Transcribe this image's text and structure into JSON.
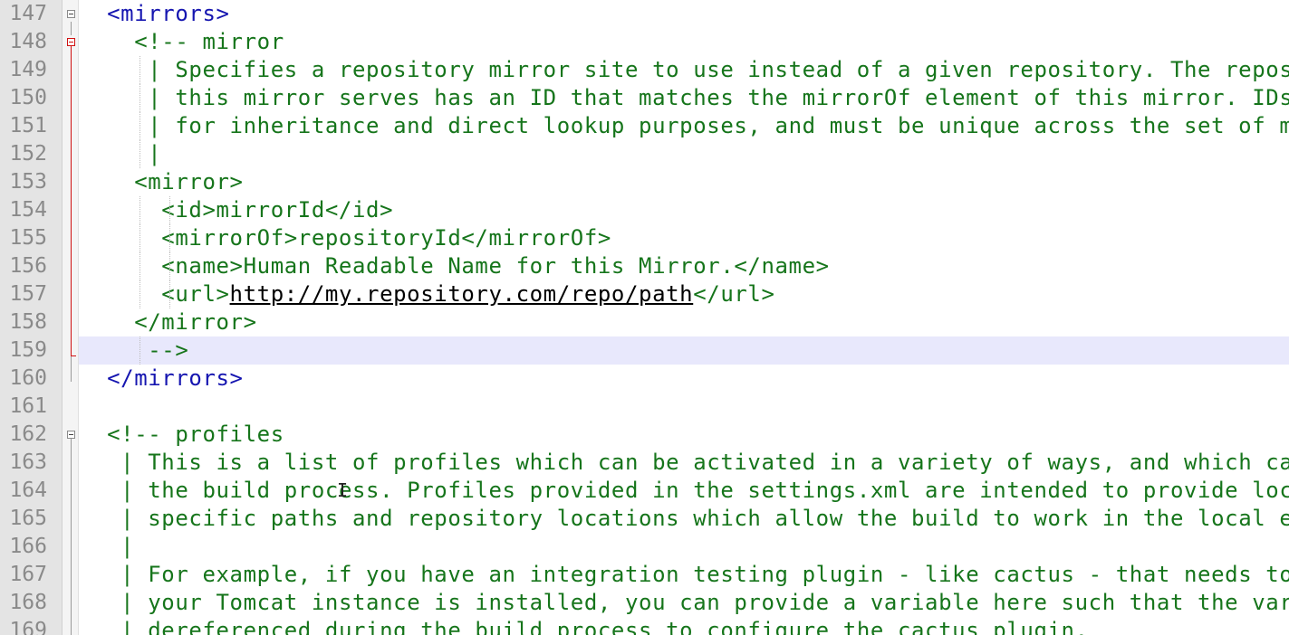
{
  "editor": {
    "fold_icon": "fold-minus-icon",
    "current_line": 159,
    "lines": [
      {
        "n": "147",
        "indent": "  ",
        "segs": [
          {
            "t": "tag",
            "v": "<mirrors>"
          }
        ]
      },
      {
        "n": "148",
        "indent": "    ",
        "segs": [
          {
            "t": "cm",
            "v": "<!-- mirror"
          }
        ]
      },
      {
        "n": "149",
        "indent": "     ",
        "segs": [
          {
            "t": "cm",
            "v": "| Specifies a repository mirror site to use instead of a given repository. The repository that"
          }
        ]
      },
      {
        "n": "150",
        "indent": "     ",
        "segs": [
          {
            "t": "cm",
            "v": "| this mirror serves has an ID that matches the mirrorOf element of this mirror. IDs are used"
          }
        ]
      },
      {
        "n": "151",
        "indent": "     ",
        "segs": [
          {
            "t": "cm",
            "v": "| for inheritance and direct lookup purposes, and must be unique across the set of mirrors."
          }
        ]
      },
      {
        "n": "152",
        "indent": "     ",
        "segs": [
          {
            "t": "cm",
            "v": "|"
          }
        ]
      },
      {
        "n": "153",
        "indent": "    ",
        "segs": [
          {
            "t": "cm",
            "v": "<mirror>"
          }
        ]
      },
      {
        "n": "154",
        "indent": "      ",
        "segs": [
          {
            "t": "cm",
            "v": "<id>mirrorId</id>"
          }
        ]
      },
      {
        "n": "155",
        "indent": "      ",
        "segs": [
          {
            "t": "cm",
            "v": "<mirrorOf>repositoryId</mirrorOf>"
          }
        ]
      },
      {
        "n": "156",
        "indent": "      ",
        "segs": [
          {
            "t": "cm",
            "v": "<name>Human Readable Name for this Mirror.</name>"
          }
        ]
      },
      {
        "n": "157",
        "indent": "      ",
        "segs": [
          {
            "t": "cm",
            "v": "<url>"
          },
          {
            "t": "cm url",
            "v": "http://my.repository.com/repo/path"
          },
          {
            "t": "cm",
            "v": "</url>"
          }
        ]
      },
      {
        "n": "158",
        "indent": "    ",
        "segs": [
          {
            "t": "cm",
            "v": "</mirror>"
          }
        ]
      },
      {
        "n": "159",
        "indent": "     ",
        "segs": [
          {
            "t": "cm",
            "v": "-->"
          }
        ]
      },
      {
        "n": "160",
        "indent": "  ",
        "segs": [
          {
            "t": "tag",
            "v": "</mirrors>"
          }
        ]
      },
      {
        "n": "161",
        "indent": "",
        "segs": []
      },
      {
        "n": "162",
        "indent": "  ",
        "segs": [
          {
            "t": "cm",
            "v": "<!-- profiles"
          }
        ]
      },
      {
        "n": "163",
        "indent": "   ",
        "segs": [
          {
            "t": "cm",
            "v": "| This is a list of profiles which can be activated in a variety of ways, and which can modify"
          }
        ]
      },
      {
        "n": "164",
        "indent": "   ",
        "segs": [
          {
            "t": "cm",
            "v": "| the build process. Profiles provided in the settings.xml are intended to provide local machine-"
          }
        ]
      },
      {
        "n": "165",
        "indent": "   ",
        "segs": [
          {
            "t": "cm",
            "v": "| specific paths and repository locations which allow the build to work in the local environment."
          }
        ]
      },
      {
        "n": "166",
        "indent": "   ",
        "segs": [
          {
            "t": "cm",
            "v": "|"
          }
        ]
      },
      {
        "n": "167",
        "indent": "   ",
        "segs": [
          {
            "t": "cm",
            "v": "| For example, if you have an integration testing plugin - like cactus - that needs to know where"
          }
        ]
      },
      {
        "n": "168",
        "indent": "   ",
        "segs": [
          {
            "t": "cm",
            "v": "| your Tomcat instance is installed, you can provide a variable here such that the variable is"
          }
        ]
      },
      {
        "n": "169",
        "indent": "   ",
        "segs": [
          {
            "t": "cm",
            "v": "| dereferenced during the build process to configure the cactus plugin."
          }
        ]
      }
    ]
  }
}
